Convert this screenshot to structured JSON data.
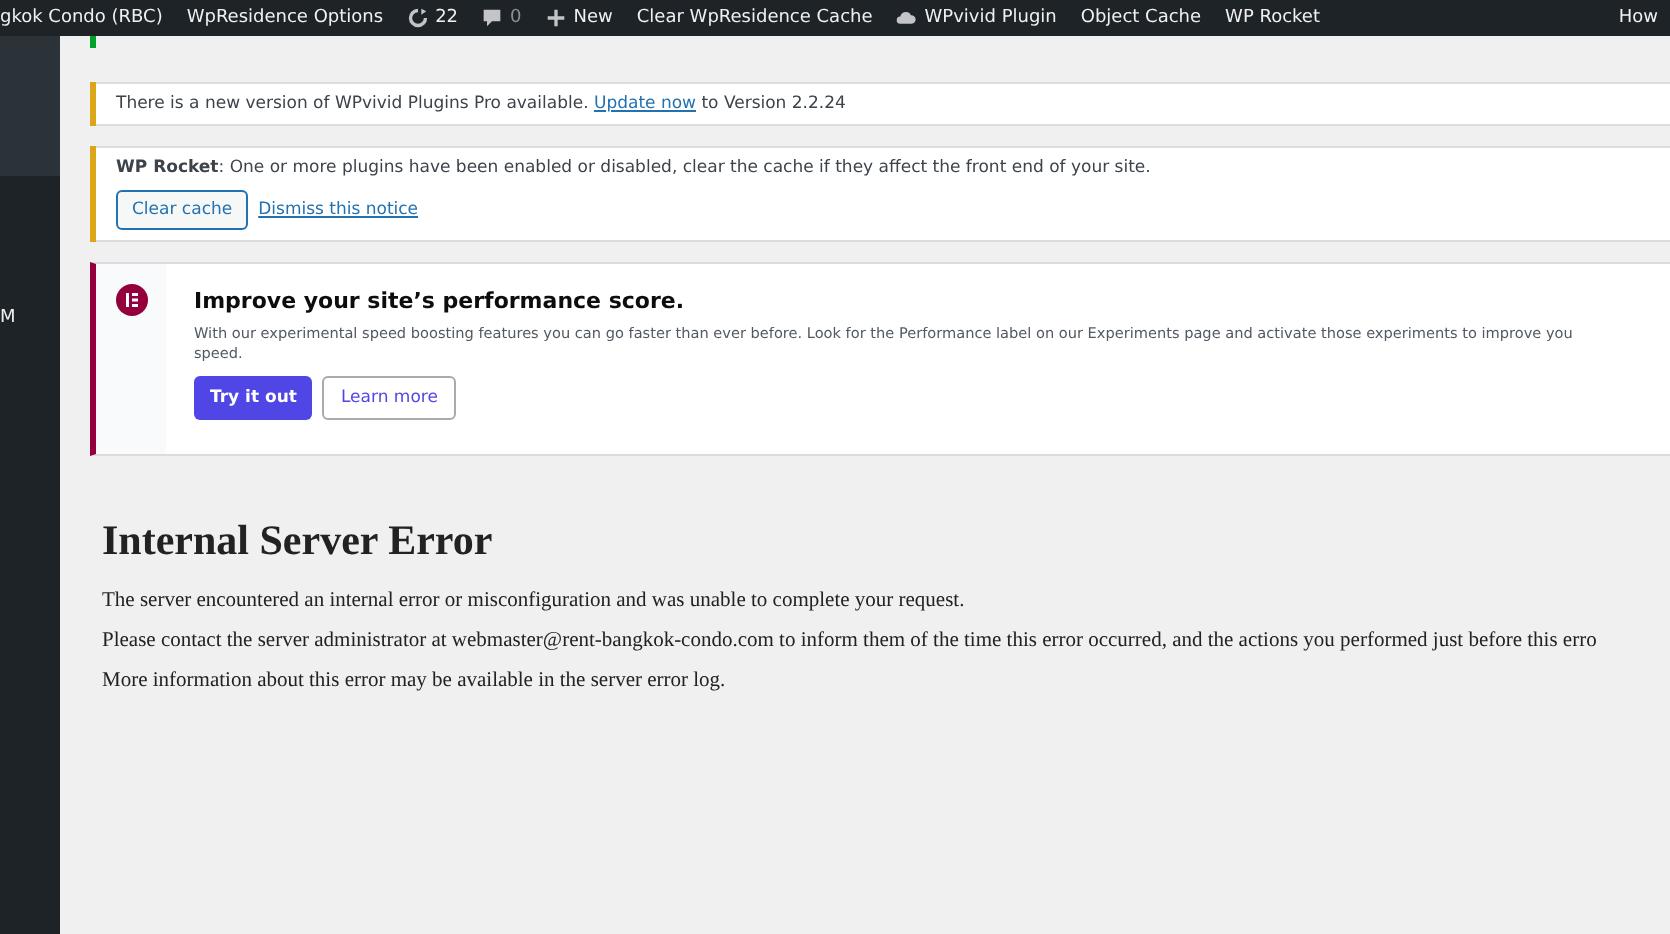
{
  "admin_bar": {
    "items": [
      {
        "kind": "text",
        "label": "gkok Condo (RBC)"
      },
      {
        "kind": "text",
        "label": "WpResidence Options"
      },
      {
        "kind": "updates",
        "label": "22"
      },
      {
        "kind": "comments",
        "label": "0"
      },
      {
        "kind": "new",
        "label": "New"
      },
      {
        "kind": "text",
        "label": "Clear WpResidence Cache"
      },
      {
        "kind": "cloud",
        "label": "WPvivid Plugin"
      },
      {
        "kind": "text",
        "label": "Object Cache"
      },
      {
        "kind": "text",
        "label": "WP Rocket"
      }
    ],
    "right": "How"
  },
  "sidebar": {
    "items": [
      {
        "label": "M"
      }
    ]
  },
  "notices": [
    {
      "kind": "cut",
      "color": "#00a32a"
    },
    {
      "kind": "update",
      "color": "#dba617",
      "before": "There is a new version of WPvivid Plugins Pro available.",
      "link": "Update now",
      "after": "to Version 2.2.24"
    },
    {
      "kind": "rocket",
      "color": "#dba617",
      "text": "**WP Rocket**: One or more plugins have been enabled or disabled, clear the cache if they affect the front end of your site.",
      "button": "Clear cache",
      "link": "Dismiss this notice"
    },
    {
      "kind": "promo",
      "color": "#93003c",
      "title": "Improve your site’s performance score.",
      "text": [
        "With our experimental speed boosting features you can go faster than ever before. Look for the Performance label on our Experiments page and activate those experiments to improve you",
        "speed."
      ],
      "primary": "Try it out",
      "secondary": "Learn more"
    }
  ],
  "error": {
    "title": "Internal Server Error",
    "paragraphs": [
      "The server encountered an internal error or misconfiguration and was unable to complete your request.",
      "Please contact the server administrator at webmaster@rent-bangkok-condo.com to inform them of the time this error occurred, and the actions you performed just before this erro",
      "More information about this error may be available in the server error log."
    ]
  }
}
